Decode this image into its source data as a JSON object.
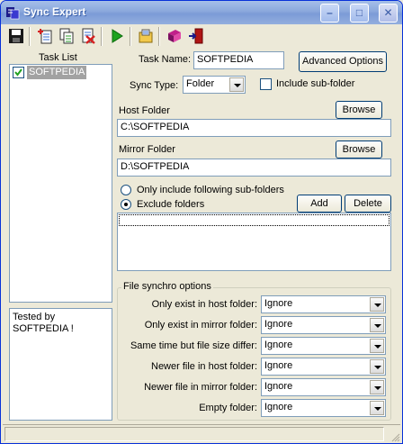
{
  "window": {
    "title": "Sync Expert"
  },
  "title_buttons": {
    "minimize": "–",
    "maximize": "□",
    "close": "✕"
  },
  "toolbar": {
    "icons": [
      "save-icon",
      "new-task-icon",
      "copy-task-icon",
      "delete-task-icon",
      "run-icon",
      "open-folder-icon",
      "help-book-icon",
      "exit-icon"
    ]
  },
  "task_list": {
    "header": "Task List",
    "items": [
      {
        "label": "SOFTPEDIA",
        "checked": true,
        "selected": true
      }
    ]
  },
  "notes": {
    "text_line1": "Tested by",
    "text_line2": "SOFTPEDIA !"
  },
  "form": {
    "task_name_label": "Task Name:",
    "task_name_value": "SOFTPEDIA",
    "advanced_options_label": "Advanced Options",
    "sync_type_label": "Sync Type:",
    "sync_type_value": "Folder",
    "include_subfolder_label": "Include sub-folder",
    "include_subfolder_checked": false,
    "host_folder_label": "Host Folder",
    "host_folder_value": "C:\\SOFTPEDIA",
    "mirror_folder_label": "Mirror Folder",
    "mirror_folder_value": "D:\\SOFTPEDIA",
    "browse_label": "Browse",
    "radio_include_label": "Only include following sub-folders",
    "radio_exclude_label": "Exclude folders",
    "selected_radio": "exclude",
    "add_label": "Add",
    "delete_label": "Delete"
  },
  "file_synchro": {
    "title": "File synchro options",
    "options": [
      {
        "label": "Only exist in host folder:",
        "value": "Ignore"
      },
      {
        "label": "Only exist in mirror folder:",
        "value": "Ignore"
      },
      {
        "label": "Same time but file size differ:",
        "value": "Ignore"
      },
      {
        "label": "Newer file in host folder:",
        "value": "Ignore"
      },
      {
        "label": "Newer file in mirror folder:",
        "value": "Ignore"
      },
      {
        "label": "Empty folder:",
        "value": "Ignore"
      }
    ]
  },
  "colors": {
    "titlebar": "#8aa7dc",
    "face": "#ece9d8",
    "selection": "#a2a2a2",
    "field_border": "#7f9db9"
  }
}
